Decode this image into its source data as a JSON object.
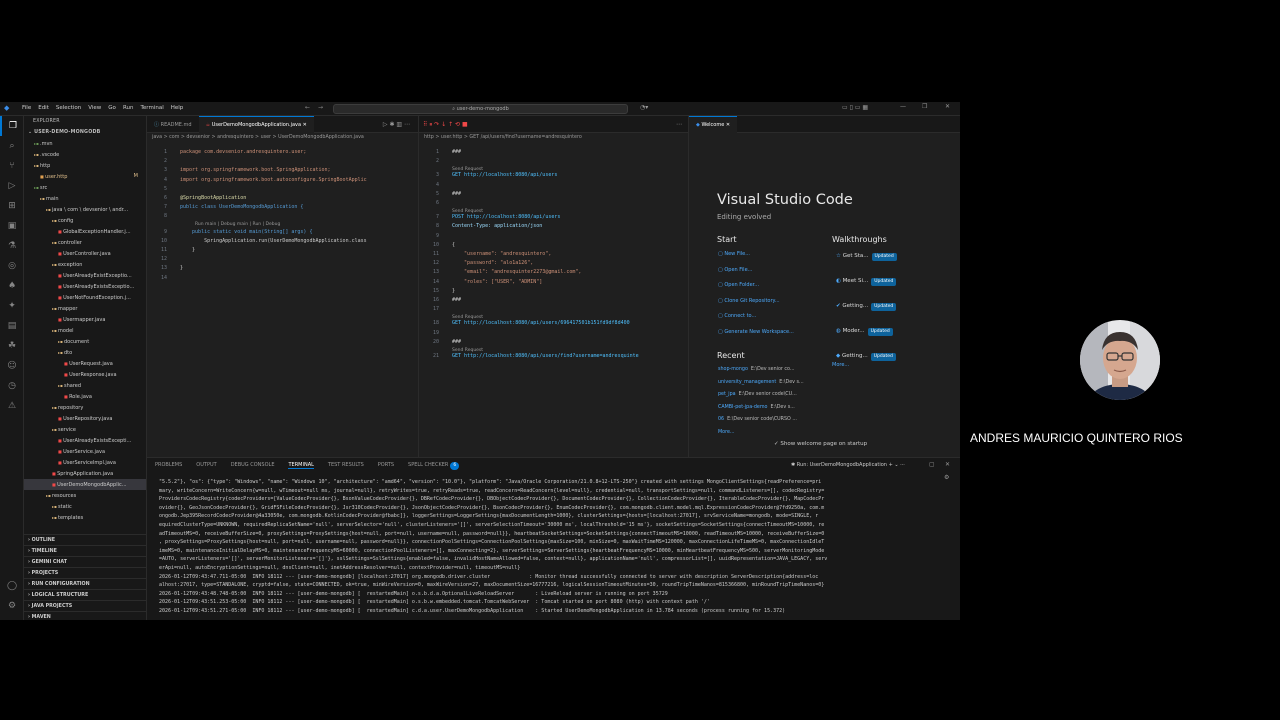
{
  "titlebar": {
    "menu": [
      "File",
      "Edit",
      "Selection",
      "View",
      "Go",
      "Run",
      "Terminal",
      "Help"
    ],
    "search": "user-demo-mongodb"
  },
  "explorer": {
    "header": "EXPLORER",
    "root": "USER-DEMO-MONGODB",
    "tree": [
      {
        "label": ".mvn",
        "depth": 1,
        "kind": "dim"
      },
      {
        "label": ".vscode",
        "depth": 1,
        "kind": "grey"
      },
      {
        "label": "http",
        "depth": 1,
        "kind": "fold"
      },
      {
        "label": "user.http",
        "depth": 2,
        "kind": "file",
        "badge": "M"
      },
      {
        "label": "src",
        "depth": 1,
        "kind": "dim"
      },
      {
        "label": "main",
        "depth": 2,
        "kind": "fold"
      },
      {
        "label": "java \\ com \\ devsenior \\ andr...",
        "depth": 3,
        "kind": "fold"
      },
      {
        "label": "config",
        "depth": 4,
        "kind": "fold"
      },
      {
        "label": "GlobalExceptionHandler.j...",
        "depth": 5,
        "kind": "jv"
      },
      {
        "label": "controller",
        "depth": 4,
        "kind": "fold"
      },
      {
        "label": "UserController.java",
        "depth": 5,
        "kind": "jv"
      },
      {
        "label": "exception",
        "depth": 4,
        "kind": "fold"
      },
      {
        "label": "UserAlreadyExistExceptio...",
        "depth": 5,
        "kind": "jv"
      },
      {
        "label": "UserAlreadyExistsExceptio...",
        "depth": 5,
        "kind": "jv"
      },
      {
        "label": "UserNotFoundException.j...",
        "depth": 5,
        "kind": "jv"
      },
      {
        "label": "mapper",
        "depth": 4,
        "kind": "fold"
      },
      {
        "label": "Usermapper.java",
        "depth": 5,
        "kind": "jv"
      },
      {
        "label": "model",
        "depth": 4,
        "kind": "fold"
      },
      {
        "label": "document",
        "depth": 5,
        "kind": "fold"
      },
      {
        "label": "dto",
        "depth": 5,
        "kind": "fold"
      },
      {
        "label": "UserRequest.java",
        "depth": 6,
        "kind": "jv"
      },
      {
        "label": "UserResponse.java",
        "depth": 6,
        "kind": "jv"
      },
      {
        "label": "shared",
        "depth": 5,
        "kind": "fold"
      },
      {
        "label": "Role.java",
        "depth": 6,
        "kind": "jv"
      },
      {
        "label": "repository",
        "depth": 4,
        "kind": "fold"
      },
      {
        "label": "UserRepository.java",
        "depth": 5,
        "kind": "jv"
      },
      {
        "label": "service",
        "depth": 4,
        "kind": "fold"
      },
      {
        "label": "UserAlreadyExistsExcepti...",
        "depth": 5,
        "kind": "jv"
      },
      {
        "label": "UserService.java",
        "depth": 5,
        "kind": "jv"
      },
      {
        "label": "UserServiceImpl.java",
        "depth": 5,
        "kind": "jv"
      },
      {
        "label": "SpringApplication.java",
        "depth": 4,
        "kind": "jv"
      },
      {
        "label": "UserDemoMongodbApplic...",
        "depth": 4,
        "kind": "jv",
        "selected": true
      },
      {
        "label": "resources",
        "depth": 3,
        "kind": "fold"
      },
      {
        "label": "static",
        "depth": 4,
        "kind": "fold"
      },
      {
        "label": "templates",
        "depth": 4,
        "kind": "fold"
      }
    ],
    "sections": [
      "OUTLINE",
      "TIMELINE",
      "GEMINI CHAT",
      "PROJECTS",
      "RUN CONFIGURATION",
      "LOGICAL STRUCTURE",
      "JAVA PROJECTS",
      "MAVEN"
    ]
  },
  "editor1": {
    "tabs": [
      "README.md",
      "UserDemoMongodbApplication.java"
    ],
    "breadcrumb": "java > com > devsenior > andresquintero > user > UserDemoMongodbApplication.java",
    "codelens": "Run main | Debug main | Run | Debug",
    "lines": [
      {
        "n": "1",
        "t": "package com.devsenior.andresquintero.user;"
      },
      {
        "n": "2",
        "t": ""
      },
      {
        "n": "3",
        "t": "import org.springframework.boot.SpringApplication;"
      },
      {
        "n": "4",
        "t": "import org.springframework.boot.autoconfigure.SpringBootApplic"
      },
      {
        "n": "5",
        "t": ""
      },
      {
        "n": "6",
        "t": "@SpringBootApplication"
      },
      {
        "n": "7",
        "t": "public class UserDemoMongodbApplication {"
      },
      {
        "n": "8",
        "t": ""
      },
      {
        "n": "9",
        "t": "    public static void main(String[] args) {"
      },
      {
        "n": "10",
        "t": "        SpringApplication.run(UserDemoMongodbApplication.class"
      },
      {
        "n": "11",
        "t": "    }"
      },
      {
        "n": "12",
        "t": ""
      },
      {
        "n": "13",
        "t": "}"
      },
      {
        "n": "14",
        "t": ""
      }
    ]
  },
  "editor2": {
    "tab": "user.http",
    "breadcrumb": "http > user.http > GET /api/users/find?username=andresquintero",
    "send": "Send Request",
    "lines": [
      {
        "n": "1",
        "t": "###"
      },
      {
        "n": "2",
        "t": ""
      },
      {
        "n": "3",
        "t": "GET http://localhost:8080/api/users"
      },
      {
        "n": "4",
        "t": ""
      },
      {
        "n": "5",
        "t": "###"
      },
      {
        "n": "6",
        "t": ""
      },
      {
        "n": "7",
        "t": "POST http://localhost:8080/api/users"
      },
      {
        "n": "8",
        "t": "Content-Type: application/json"
      },
      {
        "n": "9",
        "t": ""
      },
      {
        "n": "10",
        "t": "{"
      },
      {
        "n": "11",
        "t": "    \"username\": \"andresquintero\","
      },
      {
        "n": "12",
        "t": "    \"password\": \"alo1a126\","
      },
      {
        "n": "13",
        "t": "    \"email\": \"andresquinter2273@gmail.com\","
      },
      {
        "n": "14",
        "t": "    \"roles\": [\"USER\", \"ADMIN\"]"
      },
      {
        "n": "15",
        "t": "}"
      },
      {
        "n": "16",
        "t": "###"
      },
      {
        "n": "17",
        "t": ""
      },
      {
        "n": "18",
        "t": "GET http://localhost:8080/api/users/696417501b151fd9df8d400"
      },
      {
        "n": "19",
        "t": ""
      },
      {
        "n": "20",
        "t": "###"
      },
      {
        "n": "21",
        "t": "GET http://localhost:8080/api/users/find?username=andresquinte"
      }
    ]
  },
  "welcome": {
    "tab": "Welcome",
    "title": "Visual Studio Code",
    "subtitle": "Editing evolved",
    "start_header": "Start",
    "start": [
      "New File...",
      "Open File...",
      "Open Folder...",
      "Clone Git Repository...",
      "Connect to...",
      "Generate New Workspace..."
    ],
    "walk_header": "Walkthroughs",
    "walkthroughs": [
      "Get Sta...",
      "Meet Si...",
      "Getting...",
      "Moder...",
      "Getting..."
    ],
    "updated": "Updated",
    "recent_header": "Recent",
    "recent": [
      {
        "name": "shop-mongo",
        "path": "E:\\Dev senior co..."
      },
      {
        "name": "university_management",
        "path": "E:\\Dev s..."
      },
      {
        "name": "pet_jpa",
        "path": "E:\\Dev senior code\\CU..."
      },
      {
        "name": "CAMBI-pet-jpa-demo",
        "path": "E:\\Dev s..."
      },
      {
        "name": "06",
        "path": "E:\\Dev senior code\\CURSO ..."
      }
    ],
    "more": "More...",
    "more2": "More...",
    "show_on_startup": "Show welcome page on startup"
  },
  "panel": {
    "tabs": [
      "PROBLEMS",
      "OUTPUT",
      "DEBUG CONSOLE",
      "TERMINAL",
      "TEST RESULTS",
      "PORTS",
      "SPELL CHECKER"
    ],
    "spell_count": "6",
    "run_label": "Run: UserDemoMongodbApplication",
    "terminal": [
      "\"5.5.2\"}, \"os\": {\"type\": \"Windows\", \"name\": \"Windows 10\", \"architecture\": \"amd64\", \"version\": \"10.0\"}, \"platform\": \"Java/Oracle Corporation/21.0.8+12-LTS-250\"} created with settings MongoClientSettings{readPreference=pri",
      "mary, writeConcern=WriteConcern{w=null, wTimeout=null ms, journal=null}, retryWrites=true, retryReads=true, readConcern=ReadConcern{level=null}, credential=null, transportSettings=null, commandListeners=[], codecRegistry=",
      "ProvidersCodecRegistry{codecProviders=[ValueCodecProvider{}, BsonValueCodecProvider{}, DBRefCodecProvider{}, DBObjectCodecProvider{}, DocumentCodecProvider{}, CollectionCodecProvider{}, IterableCodecProvider{}, MapCodecPr",
      "ovider{}, GeoJsonCodecProvider{}, GridFSFileCodecProvider{}, Jsr310CodecProvider{}, JsonObjectCodecProvider{}, BsonCodecProvider{}, EnumCodecProvider{}, com.mongodb.client.model.mql.ExpressionCodecProvider@7fd9250a, com.m",
      "ongodb.Jep395RecordCodecProvider@4a33050e, com.mongodb.KotlinCodecProvider@fbabc]}, loggerSettings=LoggerSettings{maxDocumentLength=1000}, clusterSettings={hosts=[localhost:27017], srvServiceName=mongodb, mode=SINGLE, r",
      "equiredClusterType=UNKNOWN, requiredReplicaSetName='null', serverSelector='null', clusterListeners='[]', serverSelectionTimeout='30000 ms', localThreshold='15 ms'}, socketSettings=SocketSettings{connectTimeoutMS=10000, re",
      "adTimeoutMS=0, receiveBufferSize=0, proxySettings=ProxySettings{host=null, port=null, username=null, password=null}}, heartbeatSocketSettings=SocketSettings{connectTimeoutMS=10000, readTimeoutMS=10000, receiveBufferSize=0",
      ", proxySettings=ProxySettings{host=null, port=null, username=null, password=null}}, connectionPoolSettings=ConnectionPoolSettings{maxSize=100, minSize=0, maxWaitTimeMS=120000, maxConnectionLifeTimeMS=0, maxConnectionIdleT",
      "imeMS=0, maintenanceInitialDelayMS=0, maintenanceFrequencyMS=60000, connectionPoolListeners=[], maxConnecting=2}, serverSettings=ServerSettings{heartbeatFrequencyMS=10000, minHeartbeatFrequencyMS=500, serverMonitoringMode",
      "=AUTO, serverListeners='[]', serverMonitorListeners='[]'}, sslSettings=SslSettings{enabled=false, invalidHostNameAllowed=false, context=null}, applicationName='null', compressorList=[], uuidRepresentation=JAVA_LEGACY, serv",
      "erApi=null, autoEncryptionSettings=null, dnsClient=null, inetAddressResolver=null, contextProvider=null, timeoutMS=null}",
      "2026-01-12T09:43:47.711-05:00  INFO 18112 --- [user-demo-mongodb] [localhost:27017] org.mongodb.driver.cluster             : Monitor thread successfully connected to server with description ServerDescription{address=loc",
      "alhost:27017, type=STANDALONE, cryptd=false, state=CONNECTED, ok=true, minWireVersion=0, maxWireVersion=27, maxDocumentSize=16777216, logicalSessionTimeoutMinutes=30, roundTripTimeNanos=815366800, minRoundTripTimeNanos=0}",
      "2026-01-12T09:43:48.748-05:00  INFO 18112 --- [user-demo-mongodb] [  restartedMain] o.s.b.d.a.OptionalLiveReloadServer       : LiveReload server is running on port 35729",
      "2026-01-12T09:43:51.253-05:00  INFO 18112 --- [user-demo-mongodb] [  restartedMain] o.s.b.w.embedded.tomcat.TomcatWebServer  : Tomcat started on port 8080 (http) with context path '/'",
      "2026-01-12T09:43:51.271-05:00  INFO 18112 --- [user-demo-mongodb] [  restartedMain] c.d.a.user.UserDemoMongodbApplication    : Started UserDemoMongodbApplication in 13.784 seconds (process running for 15.372)"
    ]
  },
  "webcam": {
    "name": "ANDRES MAURICIO QUINTERO RIOS"
  },
  "colors": {
    "accent": "#0078d4",
    "editor_bg": "#1f1f1f",
    "sidebar_bg": "#181818"
  }
}
